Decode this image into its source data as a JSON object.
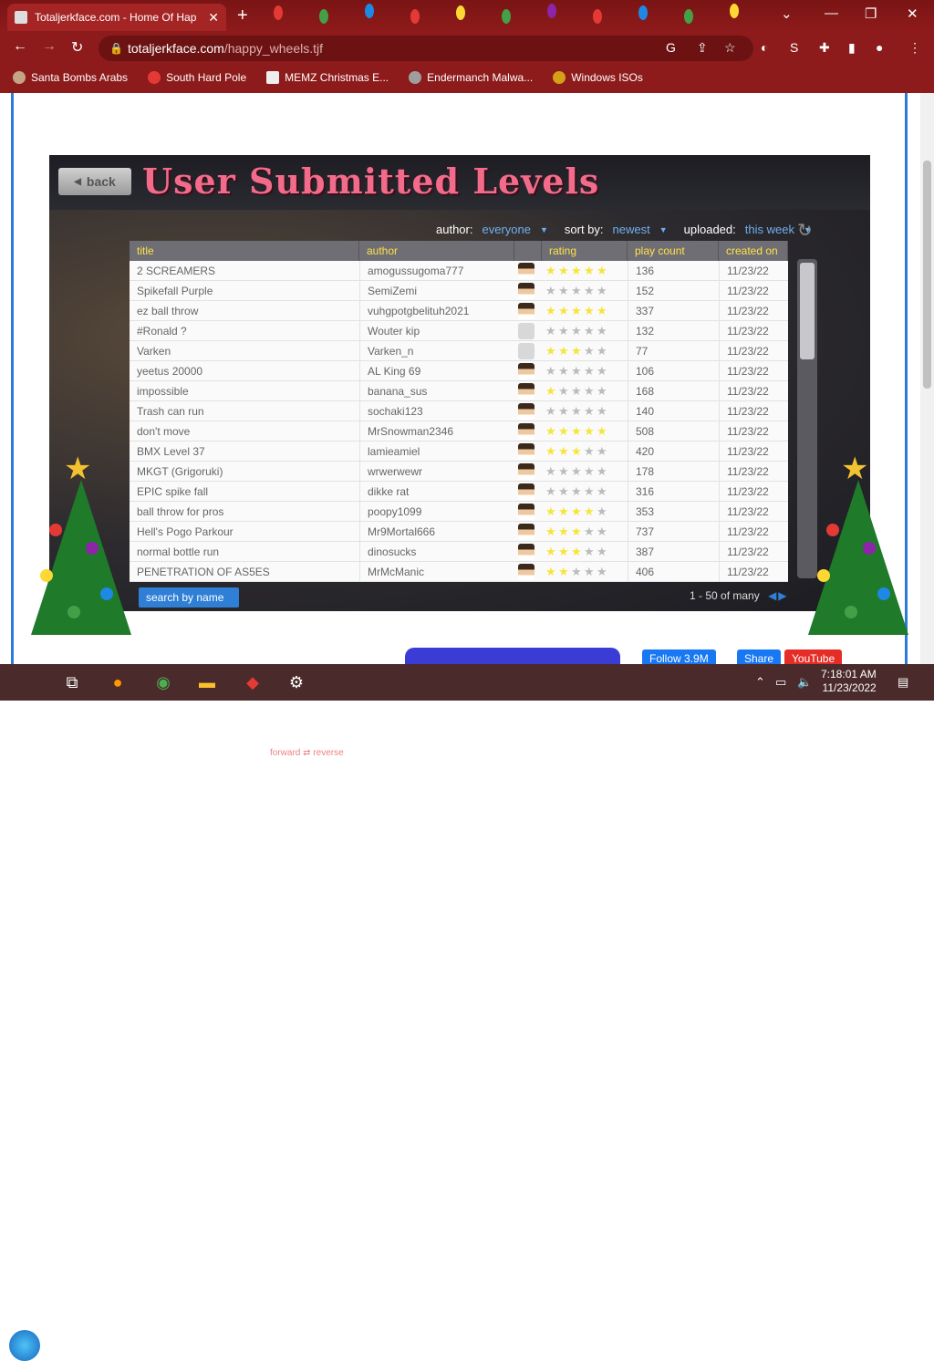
{
  "browser": {
    "tab_title": "Totaljerkface.com - Home Of Hap",
    "url_host": "totaljerkface.com",
    "url_path": "/happy_wheels.tjf",
    "bookmarks": [
      "Santa Bombs Arabs",
      "South Hard Pole",
      "MEMZ Christmas E...",
      "Endermanch Malwa...",
      "Windows ISOs"
    ]
  },
  "game": {
    "back_label": "back",
    "title": "User Submitted Levels",
    "filters": {
      "author_label": "author:",
      "author_value": "everyone",
      "sort_label": "sort by:",
      "sort_value": "newest",
      "uploaded_label": "uploaded:",
      "uploaded_value": "this week"
    },
    "columns": [
      "title",
      "author",
      "rating",
      "play count",
      "created on"
    ],
    "rows": [
      {
        "title": "2 SCREAMERS",
        "author": "amogussugoma777",
        "stars": 5,
        "plays": "136",
        "date": "11/23/22"
      },
      {
        "title": "Spikefall Purple",
        "author": "SemiZemi",
        "stars": 0,
        "plays": "152",
        "date": "11/23/22"
      },
      {
        "title": "ez ball throw",
        "author": "vuhgpotgbelituh2021",
        "stars": 5,
        "plays": "337",
        "date": "11/23/22"
      },
      {
        "title": "#Ronald ?",
        "author": "Wouter kip",
        "stars": 0,
        "plays": "132",
        "date": "11/23/22"
      },
      {
        "title": "Varken",
        "author": "Varken_n",
        "stars": 3,
        "plays": "77",
        "date": "11/23/22"
      },
      {
        "title": "yeetus 20000",
        "author": "AL King 69",
        "stars": 0,
        "plays": "106",
        "date": "11/23/22"
      },
      {
        "title": "impossible",
        "author": "banana_sus",
        "stars": 1,
        "plays": "168",
        "date": "11/23/22"
      },
      {
        "title": "Trash can run",
        "author": "sochaki123",
        "stars": 0,
        "plays": "140",
        "date": "11/23/22"
      },
      {
        "title": "don't move",
        "author": "MrSnowman2346",
        "stars": 5,
        "plays": "508",
        "date": "11/23/22"
      },
      {
        "title": "BMX Level 37",
        "author": "lamieamiel",
        "stars": 3,
        "plays": "420",
        "date": "11/23/22"
      },
      {
        "title": "MKGT (Grigoruki)",
        "author": "wrwerwewr",
        "stars": 0,
        "plays": "178",
        "date": "11/23/22"
      },
      {
        "title": "EPIC spike fall",
        "author": "dikke rat",
        "stars": 0,
        "plays": "316",
        "date": "11/23/22"
      },
      {
        "title": "ball throw for pros",
        "author": "poopy1099",
        "stars": 4,
        "plays": "353",
        "date": "11/23/22"
      },
      {
        "title": "Hell's Pogo Parkour",
        "author": "Mr9Mortal666",
        "stars": 3,
        "plays": "737",
        "date": "11/23/22"
      },
      {
        "title": "normal bottle run",
        "author": "dinosucks",
        "stars": 3,
        "plays": "387",
        "date": "11/23/22"
      },
      {
        "title": "PENETRATION OF AS5ES",
        "author": "MrMcManic",
        "stars": 2,
        "plays": "406",
        "date": "11/23/22"
      }
    ],
    "search_label": "search by name",
    "pager": "1 - 50 of many"
  },
  "footer": {
    "follow_label": "Follow 3.9M",
    "share_label": "Share",
    "youtube_label": "YouTube",
    "forward_label": "forward",
    "reverse_label": "reverse"
  },
  "taskbar": {
    "time": "7:18:01 AM",
    "date": "11/23/2022"
  }
}
